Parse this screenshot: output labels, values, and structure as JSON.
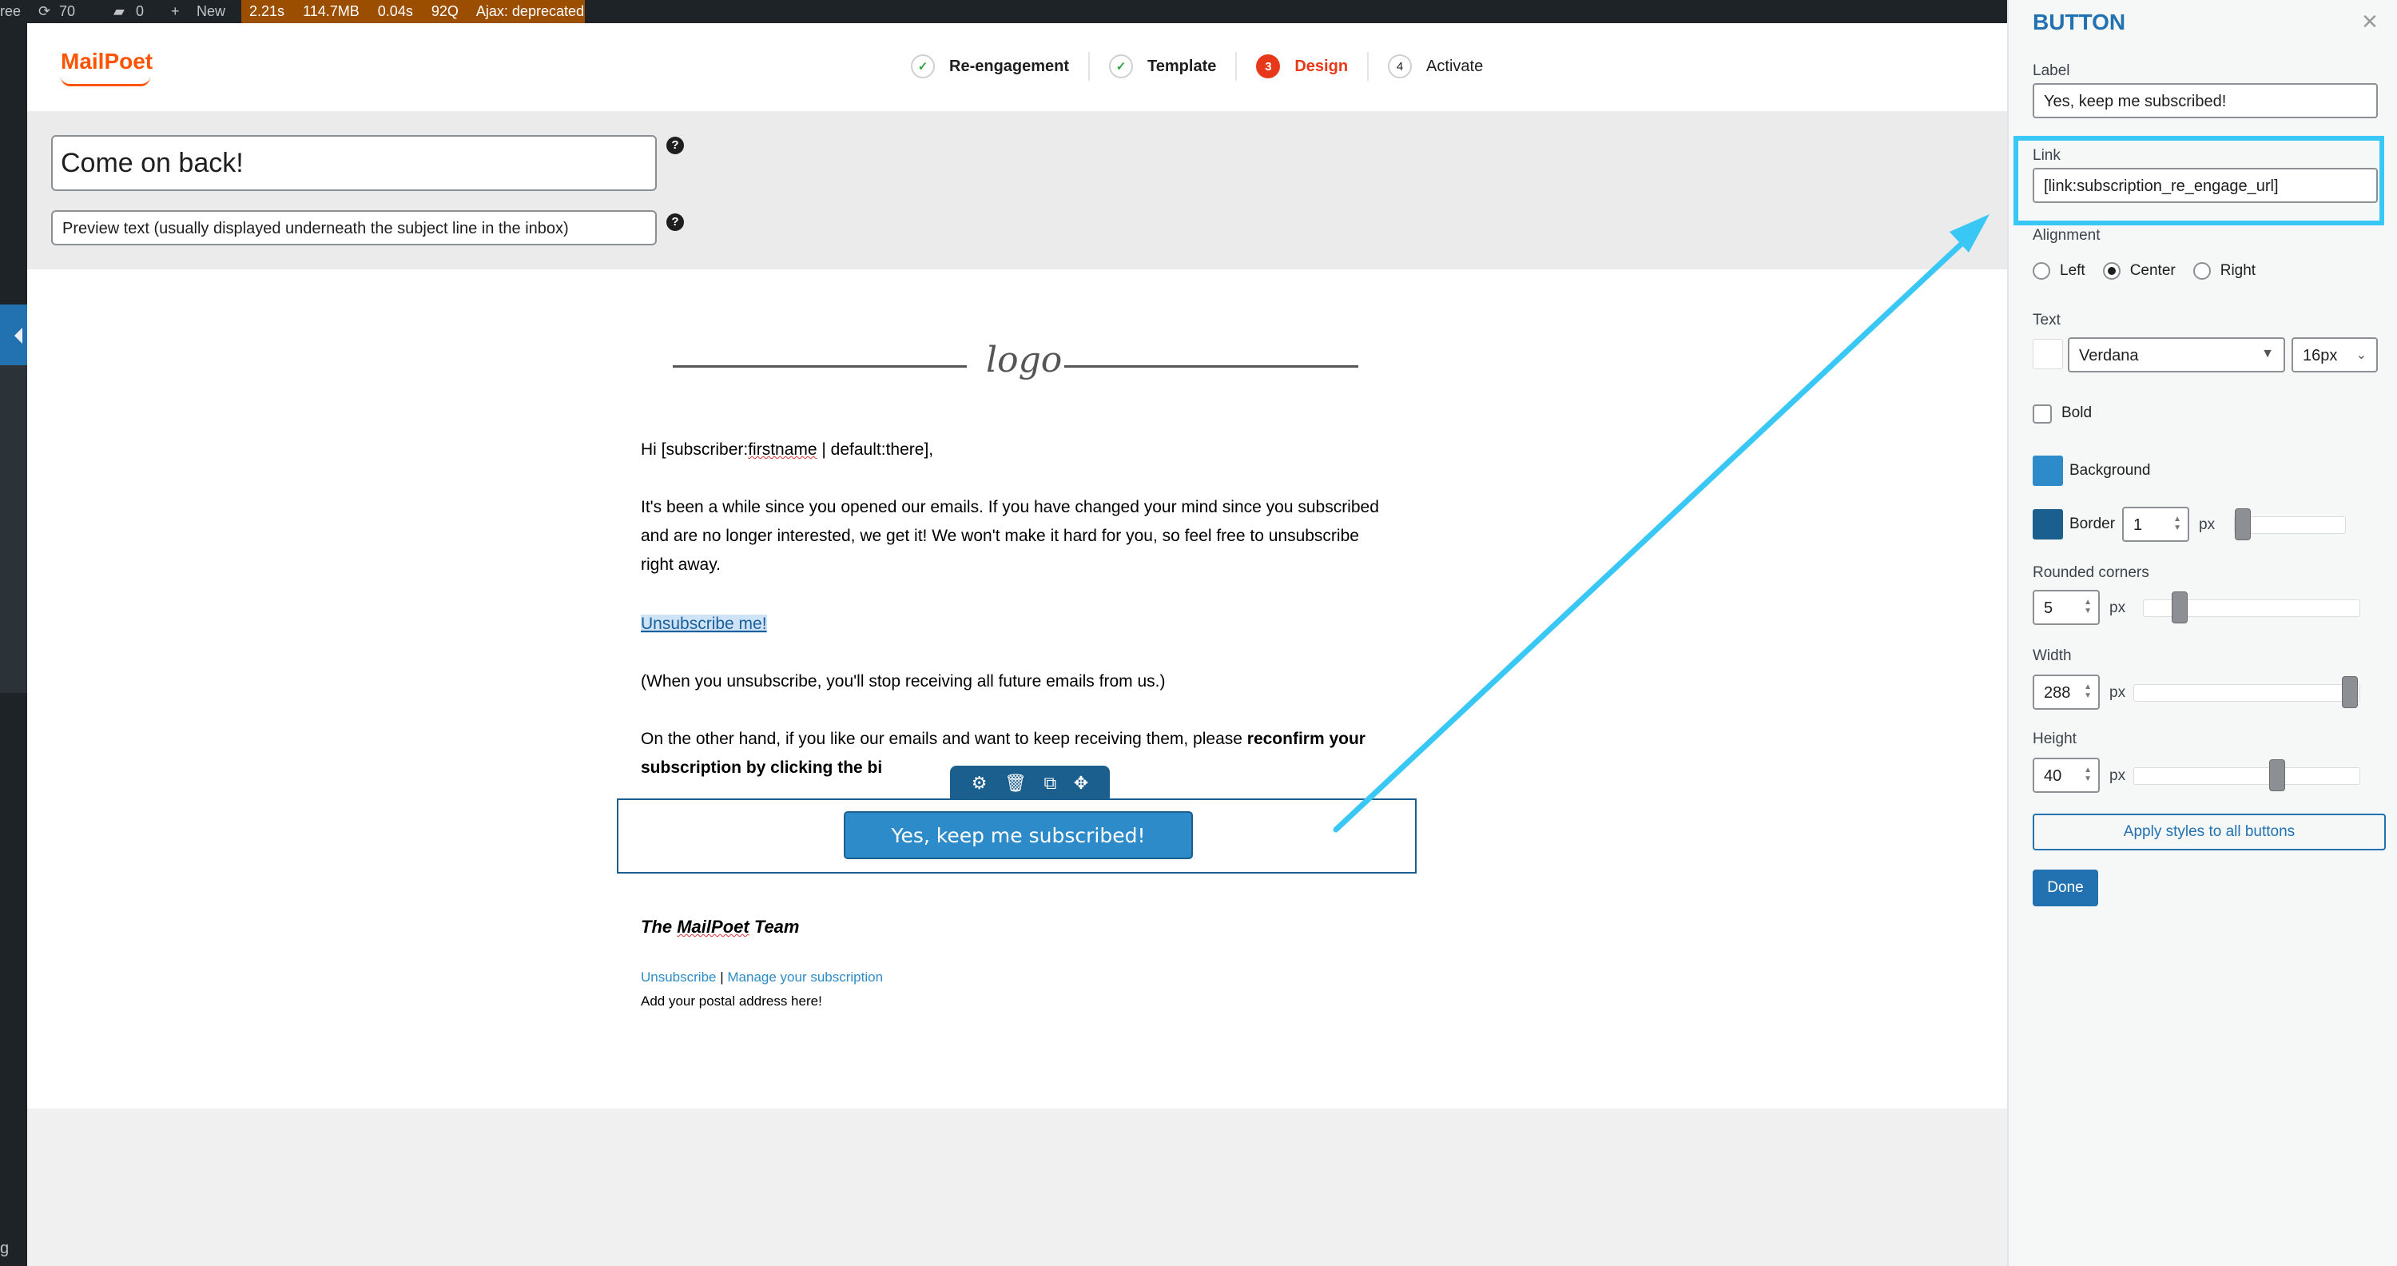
{
  "admin_bar": {
    "site_fragment": "ree",
    "updates_count": "70",
    "comments_count": "0",
    "new_label": "New",
    "query_monitor": [
      "2.21s",
      "114.7MB",
      "0.04s",
      "92Q",
      "Ajax: deprecated"
    ]
  },
  "left_menu": {
    "bottom_glyph": "g"
  },
  "header": {
    "logo": "MailPoet",
    "steps": [
      {
        "number": "✓",
        "label": "Re-engagement",
        "state": "done"
      },
      {
        "number": "✓",
        "label": "Template",
        "state": "done"
      },
      {
        "number": "3",
        "label": "Design",
        "state": "active"
      },
      {
        "number": "4",
        "label": "Activate",
        "state": "todo"
      }
    ]
  },
  "subject": {
    "value": "Come on back!",
    "preview_placeholder": "Preview text (usually displayed underneath the subject line in the inbox)",
    "help": "?"
  },
  "email": {
    "logo_text": "logo",
    "greeting_prefix": "Hi [subscriber:",
    "greeting_firstname": "firstname",
    "greeting_suffix": " | default:there],",
    "paragraph1": "It's been a while since you opened our emails. If you have changed your mind since you subscribed and are no longer interested, we get it! We won't make it hard for you, so feel free to unsubscribe right away.",
    "unsubscribe_link": "Unsubscribe me!",
    "paragraph2": "(When you unsubscribe, you'll stop receiving all future emails from us.)",
    "paragraph3_start": "On the other hand, if you like our emails and want to keep receiving them, please ",
    "paragraph3_bold": "reconfirm your subscription by clicking the bi",
    "button_label": "Yes, keep me subscribed!",
    "signature_the": "The ",
    "signature_name": "MailPoet",
    "signature_rest": " Team",
    "footer_unsubscribe": "Unsubscribe",
    "footer_separator": " | ",
    "footer_manage": "Manage your subscription",
    "footer_address": "Add your postal address here!"
  },
  "panel": {
    "title": "BUTTON",
    "close": "×",
    "label_heading": "Label",
    "label_value": "Yes, keep me subscribed!",
    "link_heading": "Link",
    "link_value": "[link:subscription_re_engage_url]",
    "alignment_heading": "Alignment",
    "alignment_options": [
      "Left",
      "Center",
      "Right"
    ],
    "alignment_selected": "Center",
    "text_heading": "Text",
    "font_family": "Verdana",
    "font_size": "16px",
    "bold_label": "Bold",
    "background_label": "Background",
    "border_label": "Border",
    "border_value": "1",
    "unit_px": "px",
    "rounded_heading": "Rounded corners",
    "rounded_value": "5",
    "width_heading": "Width",
    "width_value": "288",
    "height_heading": "Height",
    "height_value": "40",
    "apply_label": "Apply styles to all buttons",
    "done_label": "Done",
    "text_color": "#ffffff",
    "background_color": "#2e8bc9",
    "border_color": "#1b5f8f",
    "border_slider_level": 0.0,
    "rounded_slider_level": 0.14,
    "width_slider_level": 1.0,
    "height_slider_level": 0.65
  }
}
